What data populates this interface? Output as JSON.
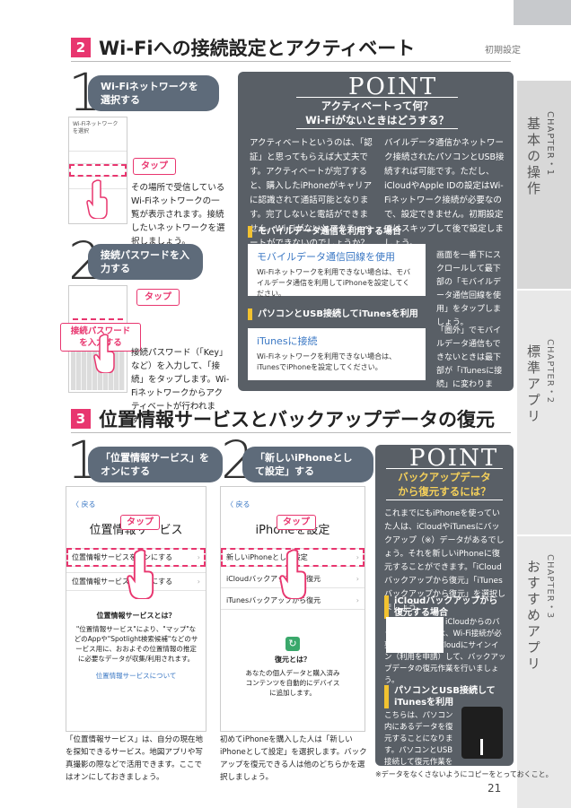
{
  "tabs": {
    "chapter1": {
      "label": "CHAPTER・1",
      "title": "基本の操作"
    },
    "chapter2": {
      "label": "CHAPTER・2",
      "title": "標準アプリ"
    },
    "chapter3": {
      "label": "CHAPTER・3",
      "title": "おすすめアプリ"
    }
  },
  "section2": {
    "number": "2",
    "title": "Wi-Fiへの接続設定とアクティベート",
    "tag": "初期設定",
    "step1": {
      "number": "1",
      "pill": "Wi-Fiネットワークを選択する",
      "phone_header": "Wi-Fiネットワークを選択",
      "tap_label": "タップ",
      "text": "その場所で受信しているWi-Fiネットワークの一覧が表示されます。接続したいネットワークを選択しましょう。"
    },
    "step2": {
      "number": "2",
      "pill": "接続パスワードを入力する",
      "tap_label": "タップ",
      "password_label": "接続パスワードを入力する",
      "text": "接続パスワード（「Key」など）を入力して、「接続」をタップします。Wi-Fiネットワークからアクティベートが行われます。"
    },
    "point": {
      "logo": "POINT",
      "heading1": "アクティベートって何？",
      "heading2": "Wi-Fiがないときはどうする？",
      "col1": "アクティベートというのは、「認証」と思ってもらえば大丈夫です。アクティベートが完了すると、購入したiPhoneがキャリアに認識されて通話可能となります。完了しないと電話ができません。Wi-Fiがないとアクティベートができないのでしょうか？　ご安心ください。モ",
      "col2": "バイルデータ通信かネットワーク接続されたパソコンとUSB接続すれば可能です。ただし、iCloudやApple IDの設定はWi-Fiネットワーク接続が必要なので、設定できません。初期設定ではスキップして後で設定しましょう。",
      "sub1": "モバイルデータ通信を利用する場合",
      "box1_title": "モバイルデータ通信回線を使用",
      "box1_text": "Wi-Fiネットワークを利用できない場合は、モバイルデータ通信を利用してiPhoneを設定してください。",
      "side1": "画面を一番下にスクロールして最下部の「モバイルデータ通信回線を使用」をタップしましょう。",
      "sub2": "パソコンとUSB接続してiTunesを利用",
      "box2_title": "iTunesに接続",
      "box2_text": "Wi-Fiネットワークを利用できない場合は、iTunesでiPhoneを設定してください。",
      "side2": "「圏外」でモバイルデータ通信もできないときは最下部が「iTunesに接続」に変わります。パソコンと接続すればアクティベートできます。"
    }
  },
  "section3": {
    "number": "3",
    "title": "位置情報サービスとバックアップデータの復元",
    "step1": {
      "number": "1",
      "pill": "「位置情報サービス」をオンにする",
      "back": "〈 戻る",
      "screen_title": "位置情報サービス",
      "tap_label": "タップ",
      "row1": "位置情報サービスをオンにする",
      "row2": "位置情報サービスをオフにする",
      "info_title": "位置情報サービスとは？",
      "info_text": "\"位置情報サービス\"により、\"マップ\"などのAppや\"Spotlight検索候補\"などのサービス用に、おおよその位置情報の推定に必要なデータが収集/利用されます。",
      "link": "位置情報サービスについて",
      "caption": "「位置情報サービス」は、自分の現在地を探知できるサービス。地図アプリや写真撮影の際などで活用できます。ここではオンにしておきましょう。"
    },
    "step2": {
      "number": "2",
      "pill": "「新しいiPhoneとして設定」する",
      "back": "〈 戻る",
      "screen_title": "iPhoneを設定",
      "tap_label": "タップ",
      "row1": "新しいiPhoneとして設定",
      "row2": "iCloudバックアップから復元",
      "row3": "iTunesバックアップから復元",
      "info_title": "復元とは？",
      "info_text": "あなたの個人データと購入済みコンテンツを自動的にデバイスに追加します。",
      "caption": "初めてiPhoneを購入した人は「新しいiPhoneとして設定」を選択します。バックアップを復元できる人は他のどちらかを選択しましょう。"
    },
    "point": {
      "logo": "POINT",
      "heading1": "バックアップデータ",
      "heading2": "から復元するには？",
      "body": "これまでにもiPhoneを使っていた人は、iCloudやiTunesにバックアップ（※）データがあるでしょう。それを新しいiPhoneに復元することができます。「iCloudバックアップから復元」「iTunesバックアップから復元」を選択しましょう。",
      "sub1": "iCloudバックアップから復元する場合",
      "sub1_text": "iCloudからのバックアップ復元は、Wi-Fi接続が必要となります。iCloudにサインイン（利用を申請）して、バックアップデータの復元作業を行いましょう。",
      "sub2": "パソコンとUSB接続してiTunesを利用",
      "sub2_text": "こちらは、パソコン内にあるデータを復元することになります。パソコンとUSB接続して復元作業を行いましょう。",
      "footnote": "※データをなくさないようにコピーをとっておくこと。"
    }
  },
  "page_number": "21"
}
